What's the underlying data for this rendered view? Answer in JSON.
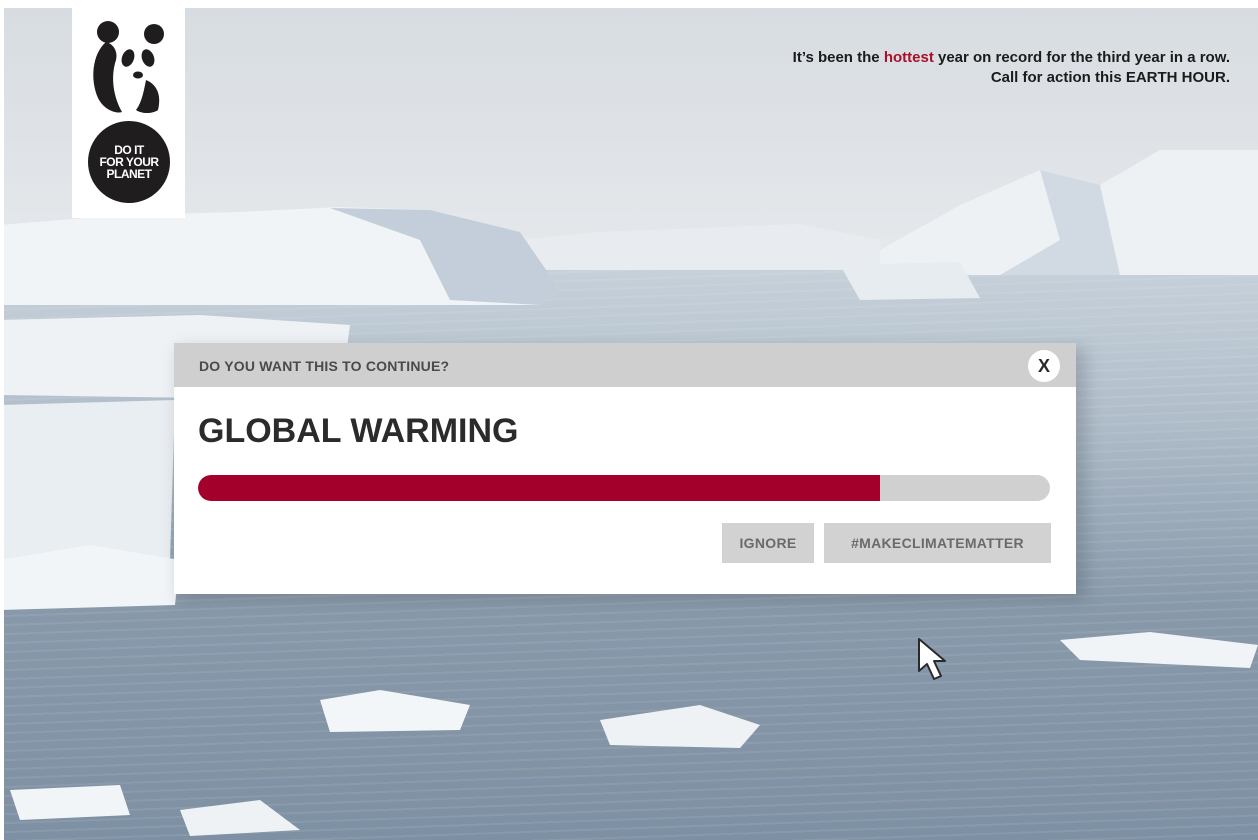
{
  "logo": {
    "panda_icon": "panda-logo",
    "badge_lines": [
      "DO IT",
      "FOR YOUR",
      "PLANET"
    ]
  },
  "headline": {
    "line1_prefix": "It’s been the ",
    "line1_highlight": "hottest",
    "line1_suffix": " year on record for the third year in a row.",
    "line2": "Call for action this EARTH HOUR.",
    "highlight_color": "#a8102a"
  },
  "dialog": {
    "question": "DO YOU WANT THIS TO CONTINUE?",
    "close_label": "X",
    "title": "GLOBAL WARMING",
    "progress_fraction": 0.8,
    "progress_color": "#a3002c",
    "buttons": {
      "ignore": "IGNORE",
      "action": "#MAKECLIMATEMATTER"
    }
  },
  "cursor_icon": "mouse-pointer-icon"
}
